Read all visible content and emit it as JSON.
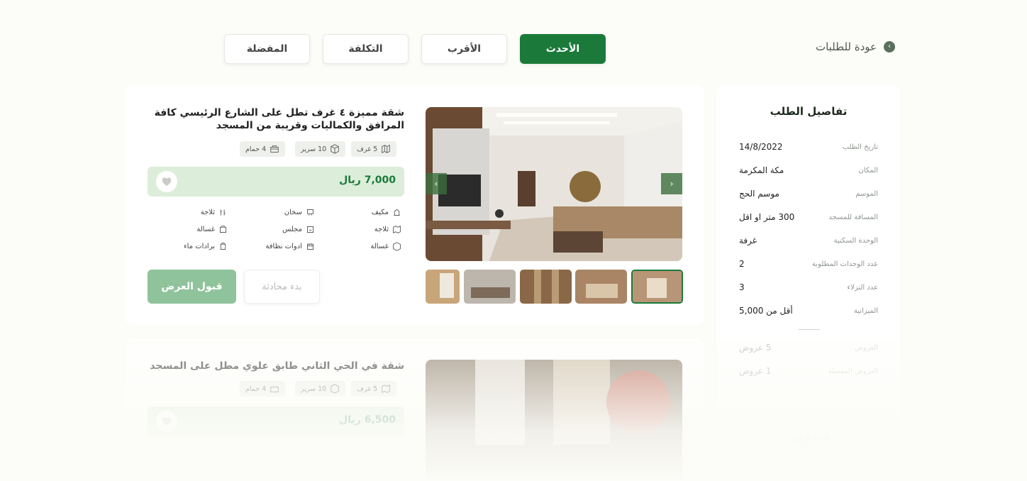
{
  "back": {
    "label": "عودة للطلبات"
  },
  "tabs": [
    {
      "label": "الأحدث"
    },
    {
      "label": "الأقرب"
    },
    {
      "label": "التكلفة"
    },
    {
      "label": "المفضلة"
    }
  ],
  "sidebar": {
    "title": "تفاصيل الطلب",
    "rows": [
      {
        "label": "تاريخ الطلب",
        "value": "14/8/2022"
      },
      {
        "label": "المكان",
        "value": "مكة المكرمة"
      },
      {
        "label": "الموسم",
        "value": "موسم الحج"
      },
      {
        "label": "المسافة للمسجد",
        "value": "300 متر او اقل"
      },
      {
        "label": "الوحدة السكنية",
        "value": "غرفة"
      },
      {
        "label": "عدد الوحدات المطلوبة",
        "value": "2"
      },
      {
        "label": "عدد النزلاء",
        "value": "3"
      },
      {
        "label": "الميزانية",
        "value": "أقل من 5,000"
      },
      {
        "label": "العروض",
        "value": "5 عروض"
      },
      {
        "label": "العروض المفضلة",
        "value": "1 عروض"
      }
    ],
    "action": "الغاء الطلب"
  },
  "offers": [
    {
      "title": "شقة مميزة ٤ غرف تطل على الشارع الرئيسي كافة المرافق والكماليات وقريبة من المسجد",
      "chips": [
        "5 غرف",
        "10 سرير",
        "4 حمام"
      ],
      "price": "7,000 ريال",
      "amenities": [
        [
          "مكيف",
          "سخان",
          "ثلاجة"
        ],
        [
          "ثلاجة",
          "مجلس",
          "غسالة"
        ],
        [
          "غسالة",
          "ادوات نظافة",
          "برادات ماء"
        ]
      ],
      "accept": "قبول العرض",
      "chat": "بدء محادثة"
    },
    {
      "title": "شقة في الحي الثاني طابق علوي مطل على المسجد",
      "chips": [
        "5 غرف",
        "10 سرير",
        "4 حمام"
      ],
      "price": "6,500 ريال"
    }
  ],
  "colors": {
    "accent": "#1b7a3a",
    "price_bg": "#dceed9",
    "accept_bg": "#8fc39b"
  }
}
